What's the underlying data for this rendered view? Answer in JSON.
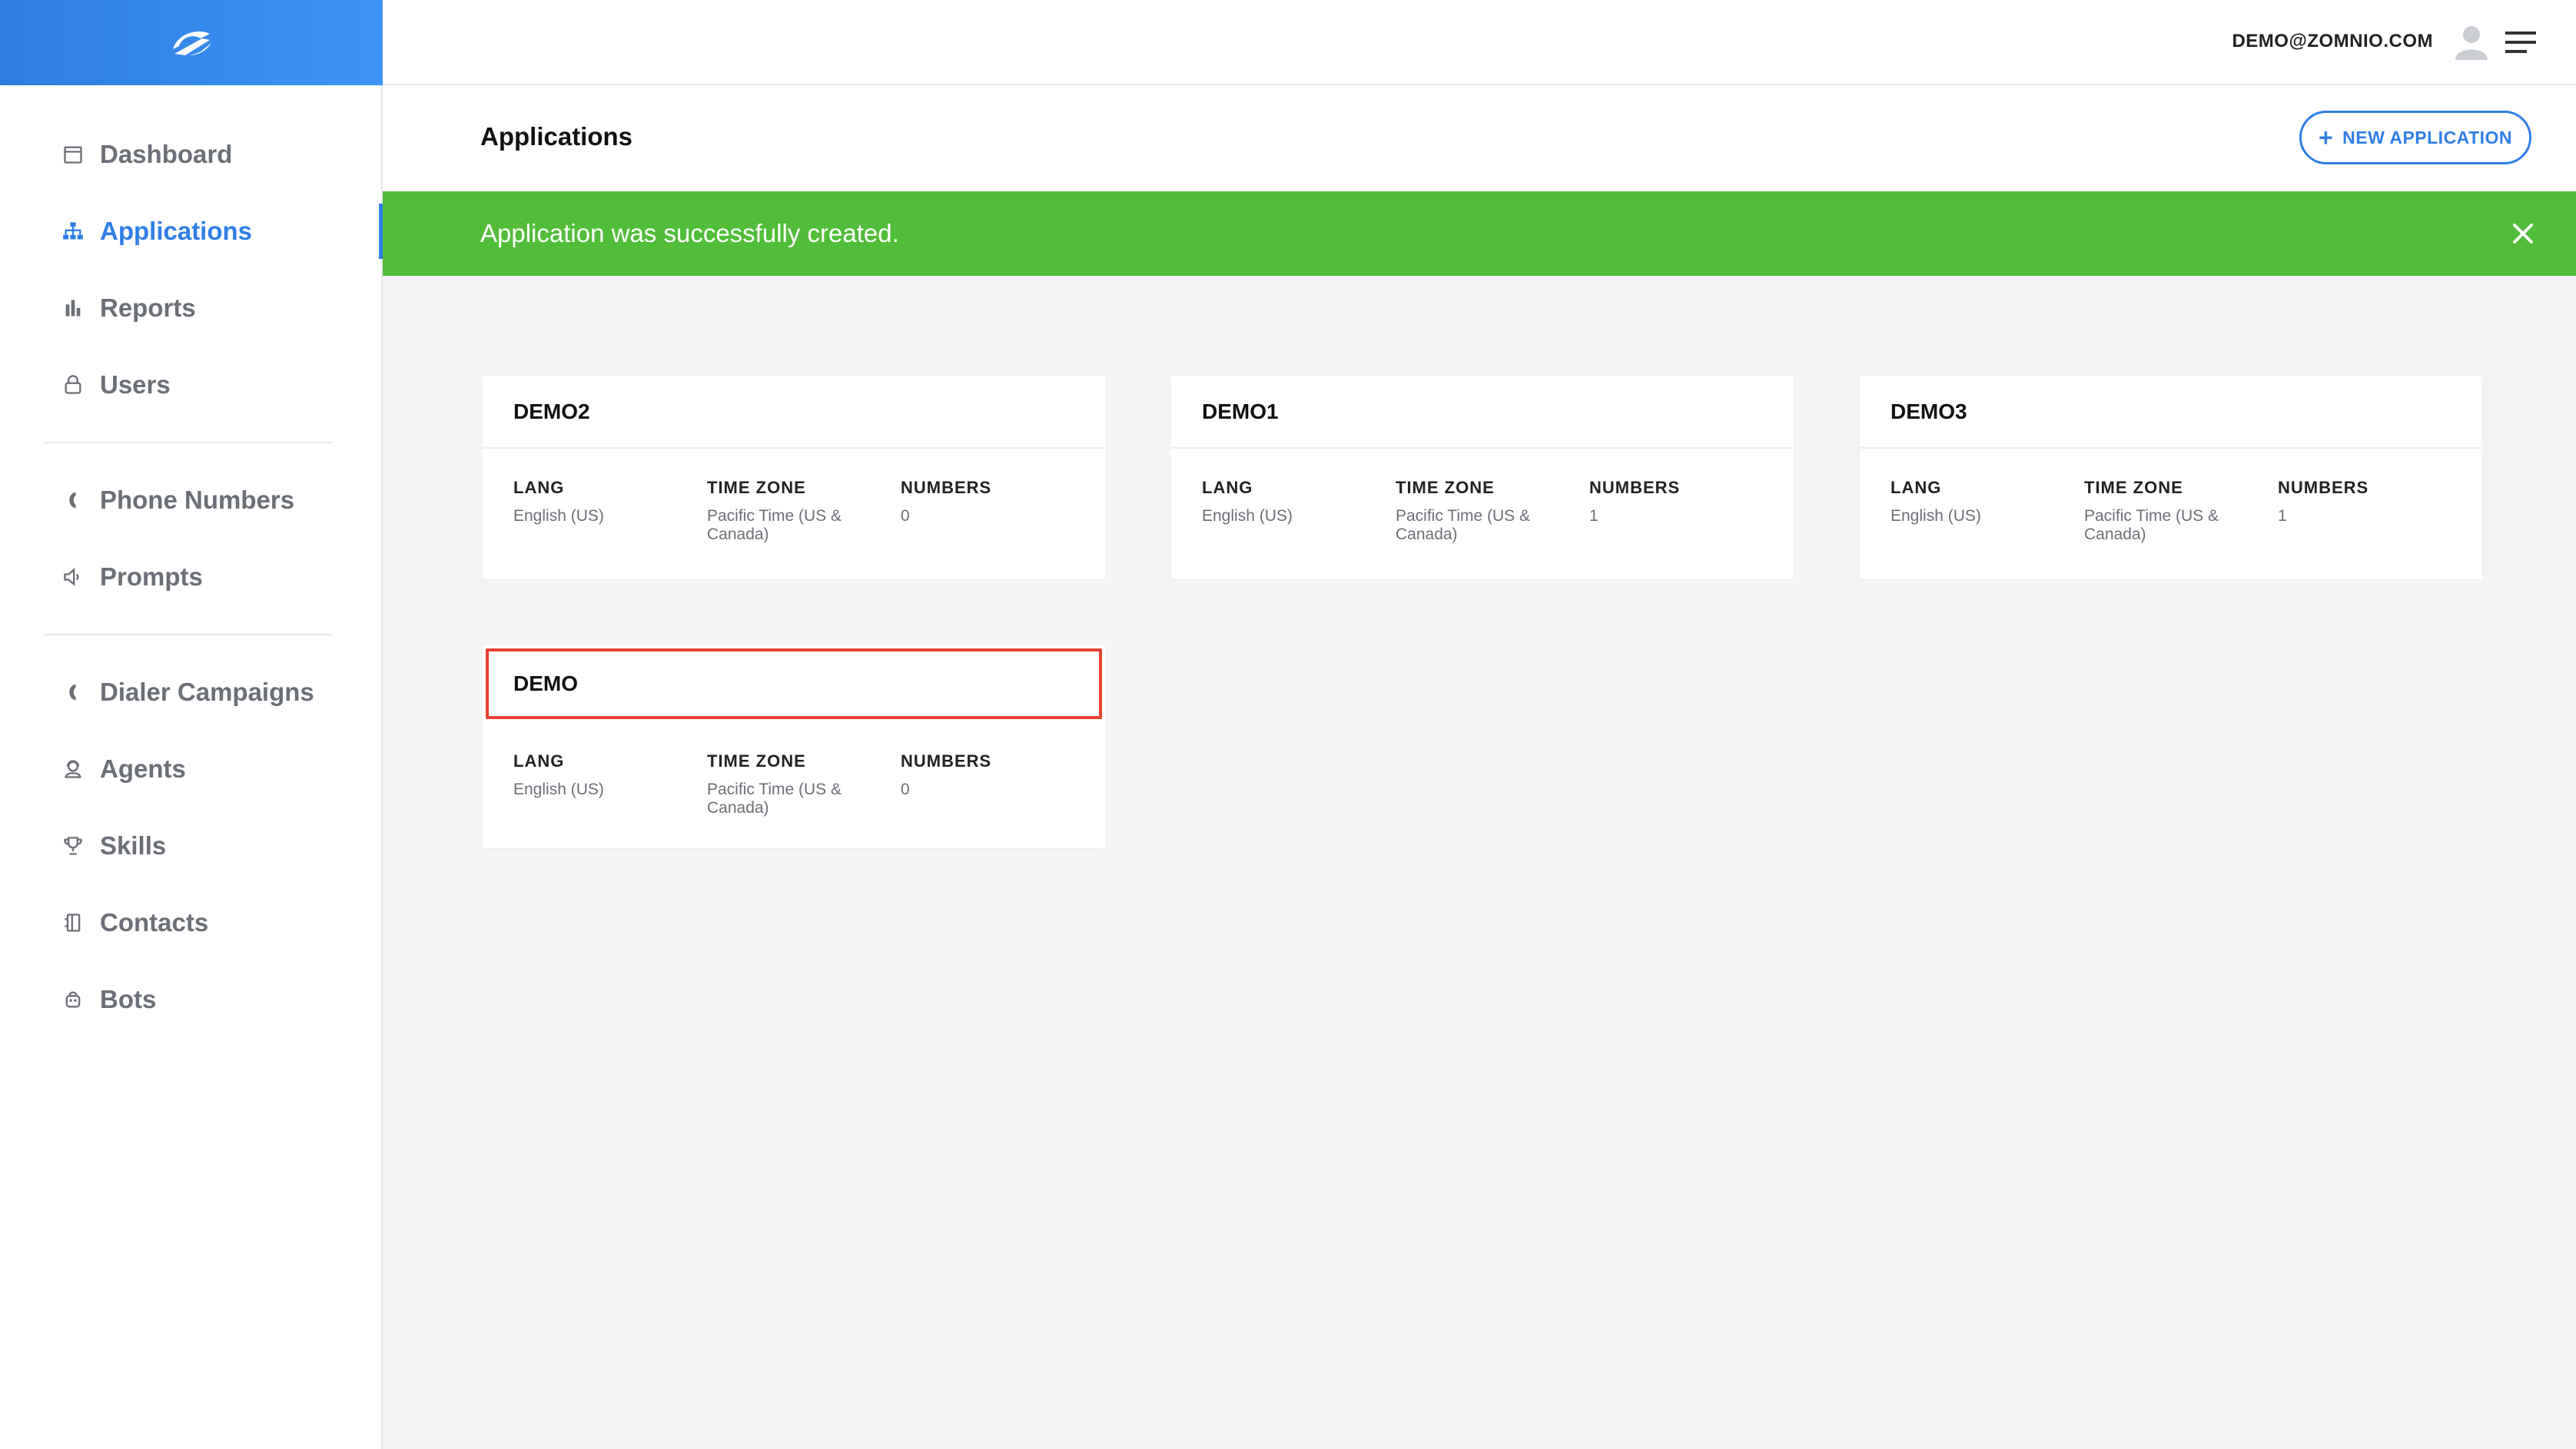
{
  "sidebar": {
    "items": [
      {
        "label": "Dashboard",
        "icon": "calendar-icon"
      },
      {
        "label": "Applications",
        "icon": "sitemap-icon",
        "active": true
      },
      {
        "label": "Reports",
        "icon": "bar-chart-icon"
      },
      {
        "label": "Users",
        "icon": "user-icon"
      },
      {
        "label": "Phone Numbers",
        "icon": "phone-icon"
      },
      {
        "label": "Prompts",
        "icon": "speaker-icon"
      },
      {
        "label": "Dialer Campaigns",
        "icon": "phone-icon"
      },
      {
        "label": "Agents",
        "icon": "agent-icon"
      },
      {
        "label": "Skills",
        "icon": "trophy-icon"
      },
      {
        "label": "Contacts",
        "icon": "address-book-icon"
      },
      {
        "label": "Bots",
        "icon": "bot-icon"
      }
    ]
  },
  "topbar": {
    "user_email": "DEMO@ZOMNIO.COM"
  },
  "page": {
    "title": "Applications",
    "new_button_label": "NEW APPLICATION"
  },
  "banner": {
    "message": "Application was successfully created.",
    "color": "#52bd3a"
  },
  "cards": [
    {
      "name": "DEMO2",
      "lang_label": "LANG",
      "lang": "English (US)",
      "tz_label": "TIME ZONE",
      "tz": "Pacific Time (US & Canada)",
      "num_label": "NUMBERS",
      "numbers": "0"
    },
    {
      "name": "DEMO1",
      "lang_label": "LANG",
      "lang": "English (US)",
      "tz_label": "TIME ZONE",
      "tz": "Pacific Time (US & Canada)",
      "num_label": "NUMBERS",
      "numbers": "1"
    },
    {
      "name": "DEMO3",
      "lang_label": "LANG",
      "lang": "English (US)",
      "tz_label": "TIME ZONE",
      "tz": "Pacific Time (US & Canada)",
      "num_label": "NUMBERS",
      "numbers": "1"
    },
    {
      "name": "DEMO",
      "lang_label": "LANG",
      "lang": "English (US)",
      "tz_label": "TIME ZONE",
      "tz": "Pacific Time (US & Canada)",
      "num_label": "NUMBERS",
      "numbers": "0"
    }
  ],
  "colors": {
    "accent": "#2f7fe6",
    "highlight": "#e8412f"
  }
}
